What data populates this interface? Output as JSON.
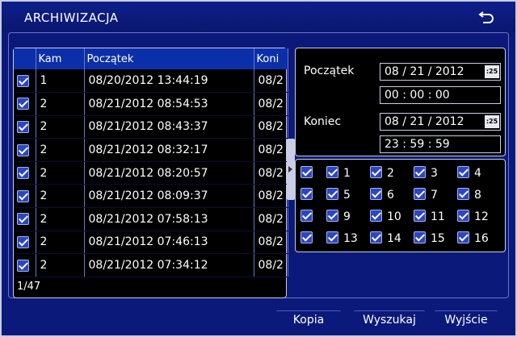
{
  "window": {
    "title": "ARCHIWIZACJA",
    "back_icon": "undo-arrow-icon"
  },
  "table": {
    "headers": [
      "",
      "Kam",
      "Początek",
      "Koni"
    ],
    "rows": [
      {
        "cam": "1",
        "start": "08/20/2012 13:44:19",
        "end": "08/2",
        "checked": true
      },
      {
        "cam": "2",
        "start": "08/21/2012 08:54:53",
        "end": "08/2",
        "checked": true
      },
      {
        "cam": "2",
        "start": "08/21/2012 08:43:37",
        "end": "08/2",
        "checked": true
      },
      {
        "cam": "2",
        "start": "08/21/2012 08:32:17",
        "end": "08/2",
        "checked": true
      },
      {
        "cam": "2",
        "start": "08/21/2012 08:20:57",
        "end": "08/2",
        "checked": true
      },
      {
        "cam": "2",
        "start": "08/21/2012 08:09:37",
        "end": "08/2",
        "checked": true
      },
      {
        "cam": "2",
        "start": "08/21/2012 07:58:13",
        "end": "08/2",
        "checked": true
      },
      {
        "cam": "2",
        "start": "08/21/2012 07:46:13",
        "end": "08/2",
        "checked": true
      },
      {
        "cam": "2",
        "start": "08/21/2012 07:34:12",
        "end": "08/2",
        "checked": true
      }
    ],
    "pager": "1/47"
  },
  "search": {
    "start_label": "Początek",
    "start_date": "08 / 21 / 2012",
    "start_time": "00  :  00  :  00",
    "end_label": "Koniec",
    "end_date": "08 / 21 / 2012",
    "end_time": "23  :  59  :  59",
    "calendar_icon_text": ":25"
  },
  "cameras": [
    "",
    "1",
    "2",
    "3",
    "4",
    "",
    "5",
    "6",
    "7",
    "8",
    "",
    "9",
    "10",
    "11",
    "12",
    "",
    "13",
    "14",
    "15",
    "16"
  ],
  "buttons": {
    "copy": "Kopia",
    "search": "Wyszukaj",
    "exit": "Wyjście"
  }
}
